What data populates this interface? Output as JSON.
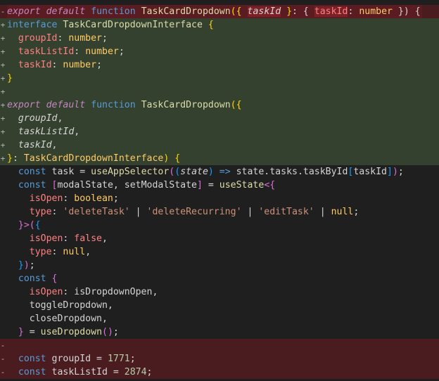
{
  "editor": {
    "lines": [
      {
        "kind": "del",
        "gutter": "-",
        "tokens": [
          {
            "t": "export",
            "c": "kw"
          },
          {
            "t": " ",
            "c": "pl"
          },
          {
            "t": "default",
            "c": "kw"
          },
          {
            "t": " ",
            "c": "pl"
          },
          {
            "t": "function",
            "c": "fn-kw"
          },
          {
            "t": " ",
            "c": "pl"
          },
          {
            "t": "TaskCardDropdown",
            "c": "fn"
          },
          {
            "t": "({",
            "c": "br1"
          },
          {
            "t": " ",
            "c": "pl"
          },
          {
            "t": "taskId",
            "c": "it hl-token"
          },
          {
            "t": " }",
            "c": "br1"
          },
          {
            "t": ": { ",
            "c": "pl"
          },
          {
            "t": "taskId",
            "c": "prop hl-token"
          },
          {
            "t": ": ",
            "c": "pl"
          },
          {
            "t": "number",
            "c": "ty"
          },
          {
            "t": " }",
            "c": "pl"
          },
          {
            "t": ") {",
            "c": "pl"
          }
        ]
      },
      {
        "kind": "add",
        "gutter": "+",
        "tokens": [
          {
            "t": "interface",
            "c": "fn-kw"
          },
          {
            "t": " ",
            "c": "pl"
          },
          {
            "t": "TaskCardDropdownInterface",
            "c": "fn"
          },
          {
            "t": " ",
            "c": "pl"
          },
          {
            "t": "{",
            "c": "br1"
          }
        ]
      },
      {
        "kind": "add",
        "gutter": "+",
        "tokens": [
          {
            "t": "  ",
            "c": "pl"
          },
          {
            "t": "groupId",
            "c": "prop"
          },
          {
            "t": ": ",
            "c": "pl"
          },
          {
            "t": "number",
            "c": "ty"
          },
          {
            "t": ";",
            "c": "pl"
          }
        ]
      },
      {
        "kind": "add",
        "gutter": "+",
        "tokens": [
          {
            "t": "  ",
            "c": "pl"
          },
          {
            "t": "taskListId",
            "c": "prop"
          },
          {
            "t": ": ",
            "c": "pl"
          },
          {
            "t": "number",
            "c": "ty"
          },
          {
            "t": ";",
            "c": "pl"
          }
        ]
      },
      {
        "kind": "add",
        "gutter": "+",
        "tokens": [
          {
            "t": "  ",
            "c": "pl"
          },
          {
            "t": "taskId",
            "c": "prop"
          },
          {
            "t": ": ",
            "c": "pl"
          },
          {
            "t": "number",
            "c": "ty"
          },
          {
            "t": ";",
            "c": "pl"
          }
        ]
      },
      {
        "kind": "add",
        "gutter": "+",
        "tokens": [
          {
            "t": "}",
            "c": "br1"
          }
        ]
      },
      {
        "kind": "add",
        "gutter": "+",
        "tokens": []
      },
      {
        "kind": "add",
        "gutter": "+",
        "tokens": [
          {
            "t": "export",
            "c": "kw"
          },
          {
            "t": " ",
            "c": "pl"
          },
          {
            "t": "default",
            "c": "kw"
          },
          {
            "t": " ",
            "c": "pl"
          },
          {
            "t": "function",
            "c": "fn-kw"
          },
          {
            "t": " ",
            "c": "pl"
          },
          {
            "t": "TaskCardDropdown",
            "c": "fn"
          },
          {
            "t": "({",
            "c": "br1"
          }
        ]
      },
      {
        "kind": "add",
        "gutter": "+",
        "tokens": [
          {
            "t": "  ",
            "c": "pl"
          },
          {
            "t": "groupId",
            "c": "it"
          },
          {
            "t": ",",
            "c": "pl"
          }
        ]
      },
      {
        "kind": "add",
        "gutter": "+",
        "tokens": [
          {
            "t": "  ",
            "c": "pl"
          },
          {
            "t": "taskListId",
            "c": "it"
          },
          {
            "t": ",",
            "c": "pl"
          }
        ]
      },
      {
        "kind": "add",
        "gutter": "+",
        "tokens": [
          {
            "t": "  ",
            "c": "pl"
          },
          {
            "t": "taskId",
            "c": "it"
          },
          {
            "t": ",",
            "c": "pl"
          }
        ]
      },
      {
        "kind": "add",
        "gutter": "+",
        "tokens": [
          {
            "t": "}",
            "c": "br1"
          },
          {
            "t": ": ",
            "c": "pl"
          },
          {
            "t": "TaskCardDropdownInterface",
            "c": "ty"
          },
          {
            "t": ")",
            "c": "br1"
          },
          {
            "t": " ",
            "c": "pl"
          },
          {
            "t": "{",
            "c": "br1"
          }
        ]
      },
      {
        "kind": "ctx",
        "gutter": "",
        "tokens": [
          {
            "t": "  ",
            "c": "pl"
          },
          {
            "t": "const",
            "c": "fn-kw"
          },
          {
            "t": " task = ",
            "c": "pl"
          },
          {
            "t": "useAppSelector",
            "c": "fn"
          },
          {
            "t": "(",
            "c": "br2"
          },
          {
            "t": "(",
            "c": "br3"
          },
          {
            "t": "state",
            "c": "it"
          },
          {
            "t": ")",
            "c": "br3"
          },
          {
            "t": " => ",
            "c": "fn-kw"
          },
          {
            "t": "state.tasks.taskById",
            "c": "pl"
          },
          {
            "t": "[",
            "c": "br3"
          },
          {
            "t": "taskId",
            "c": "pl"
          },
          {
            "t": "]",
            "c": "br3"
          },
          {
            "t": ")",
            "c": "br2"
          },
          {
            "t": ";",
            "c": "pl"
          }
        ]
      },
      {
        "kind": "ctx",
        "gutter": "",
        "tokens": [
          {
            "t": "  ",
            "c": "pl"
          },
          {
            "t": "const",
            "c": "fn-kw"
          },
          {
            "t": " ",
            "c": "pl"
          },
          {
            "t": "[",
            "c": "br2"
          },
          {
            "t": "modalState, setModalState",
            "c": "pl"
          },
          {
            "t": "]",
            "c": "br2"
          },
          {
            "t": " = ",
            "c": "pl"
          },
          {
            "t": "useState",
            "c": "fn"
          },
          {
            "t": "<{",
            "c": "br2"
          }
        ]
      },
      {
        "kind": "ctx",
        "gutter": "",
        "tokens": [
          {
            "t": "    ",
            "c": "pl"
          },
          {
            "t": "isOpen",
            "c": "prop"
          },
          {
            "t": ": ",
            "c": "pl"
          },
          {
            "t": "boolean",
            "c": "ty"
          },
          {
            "t": ";",
            "c": "pl"
          }
        ]
      },
      {
        "kind": "ctx",
        "gutter": "",
        "tokens": [
          {
            "t": "    ",
            "c": "pl"
          },
          {
            "t": "type",
            "c": "prop"
          },
          {
            "t": ": ",
            "c": "pl"
          },
          {
            "t": "'deleteTask'",
            "c": "str"
          },
          {
            "t": " | ",
            "c": "pl"
          },
          {
            "t": "'deleteRecurring'",
            "c": "str"
          },
          {
            "t": " | ",
            "c": "pl"
          },
          {
            "t": "'editTask'",
            "c": "str"
          },
          {
            "t": " | ",
            "c": "pl"
          },
          {
            "t": "null",
            "c": "ty"
          },
          {
            "t": ";",
            "c": "pl"
          }
        ]
      },
      {
        "kind": "ctx",
        "gutter": "",
        "tokens": [
          {
            "t": "  ",
            "c": "pl"
          },
          {
            "t": "}>",
            "c": "br2"
          },
          {
            "t": "(",
            "c": "br2"
          },
          {
            "t": "{",
            "c": "br3"
          }
        ]
      },
      {
        "kind": "ctx",
        "gutter": "",
        "tokens": [
          {
            "t": "    ",
            "c": "pl"
          },
          {
            "t": "isOpen",
            "c": "prop"
          },
          {
            "t": ": ",
            "c": "pl"
          },
          {
            "t": "false",
            "c": "bool"
          },
          {
            "t": ",",
            "c": "pl"
          }
        ]
      },
      {
        "kind": "ctx",
        "gutter": "",
        "tokens": [
          {
            "t": "    ",
            "c": "pl"
          },
          {
            "t": "type",
            "c": "prop"
          },
          {
            "t": ": ",
            "c": "pl"
          },
          {
            "t": "null",
            "c": "ty"
          },
          {
            "t": ",",
            "c": "pl"
          }
        ]
      },
      {
        "kind": "ctx",
        "gutter": "",
        "tokens": [
          {
            "t": "  ",
            "c": "pl"
          },
          {
            "t": "}",
            "c": "br3"
          },
          {
            "t": ")",
            "c": "br2"
          },
          {
            "t": ";",
            "c": "pl"
          }
        ]
      },
      {
        "kind": "ctx",
        "gutter": "",
        "tokens": [
          {
            "t": "  ",
            "c": "pl"
          },
          {
            "t": "const",
            "c": "fn-kw"
          },
          {
            "t": " ",
            "c": "pl"
          },
          {
            "t": "{",
            "c": "br2"
          }
        ]
      },
      {
        "kind": "ctx",
        "gutter": "",
        "tokens": [
          {
            "t": "    ",
            "c": "pl"
          },
          {
            "t": "isOpen",
            "c": "prop"
          },
          {
            "t": ": isDropdownOpen,",
            "c": "pl"
          }
        ]
      },
      {
        "kind": "ctx",
        "gutter": "",
        "tokens": [
          {
            "t": "    toggleDropdown,",
            "c": "pl"
          }
        ]
      },
      {
        "kind": "ctx",
        "gutter": "",
        "tokens": [
          {
            "t": "    closeDropdown,",
            "c": "pl"
          }
        ]
      },
      {
        "kind": "ctx",
        "gutter": "",
        "tokens": [
          {
            "t": "  ",
            "c": "pl"
          },
          {
            "t": "}",
            "c": "br2"
          },
          {
            "t": " = ",
            "c": "pl"
          },
          {
            "t": "useDropdown",
            "c": "fn"
          },
          {
            "t": "()",
            "c": "br2"
          },
          {
            "t": ";",
            "c": "pl"
          }
        ]
      },
      {
        "kind": "del",
        "gutter": "-",
        "tokens": []
      },
      {
        "kind": "del",
        "gutter": "-",
        "tokens": [
          {
            "t": "  ",
            "c": "pl"
          },
          {
            "t": "const",
            "c": "fn-kw"
          },
          {
            "t": " groupId = ",
            "c": "pl"
          },
          {
            "t": "1771",
            "c": "num"
          },
          {
            "t": ";",
            "c": "pl"
          }
        ]
      },
      {
        "kind": "del",
        "gutter": "-",
        "tokens": [
          {
            "t": "  ",
            "c": "pl"
          },
          {
            "t": "const",
            "c": "fn-kw"
          },
          {
            "t": " taskListId = ",
            "c": "pl"
          },
          {
            "t": "2874",
            "c": "num"
          },
          {
            "t": ";",
            "c": "pl"
          }
        ]
      }
    ]
  }
}
